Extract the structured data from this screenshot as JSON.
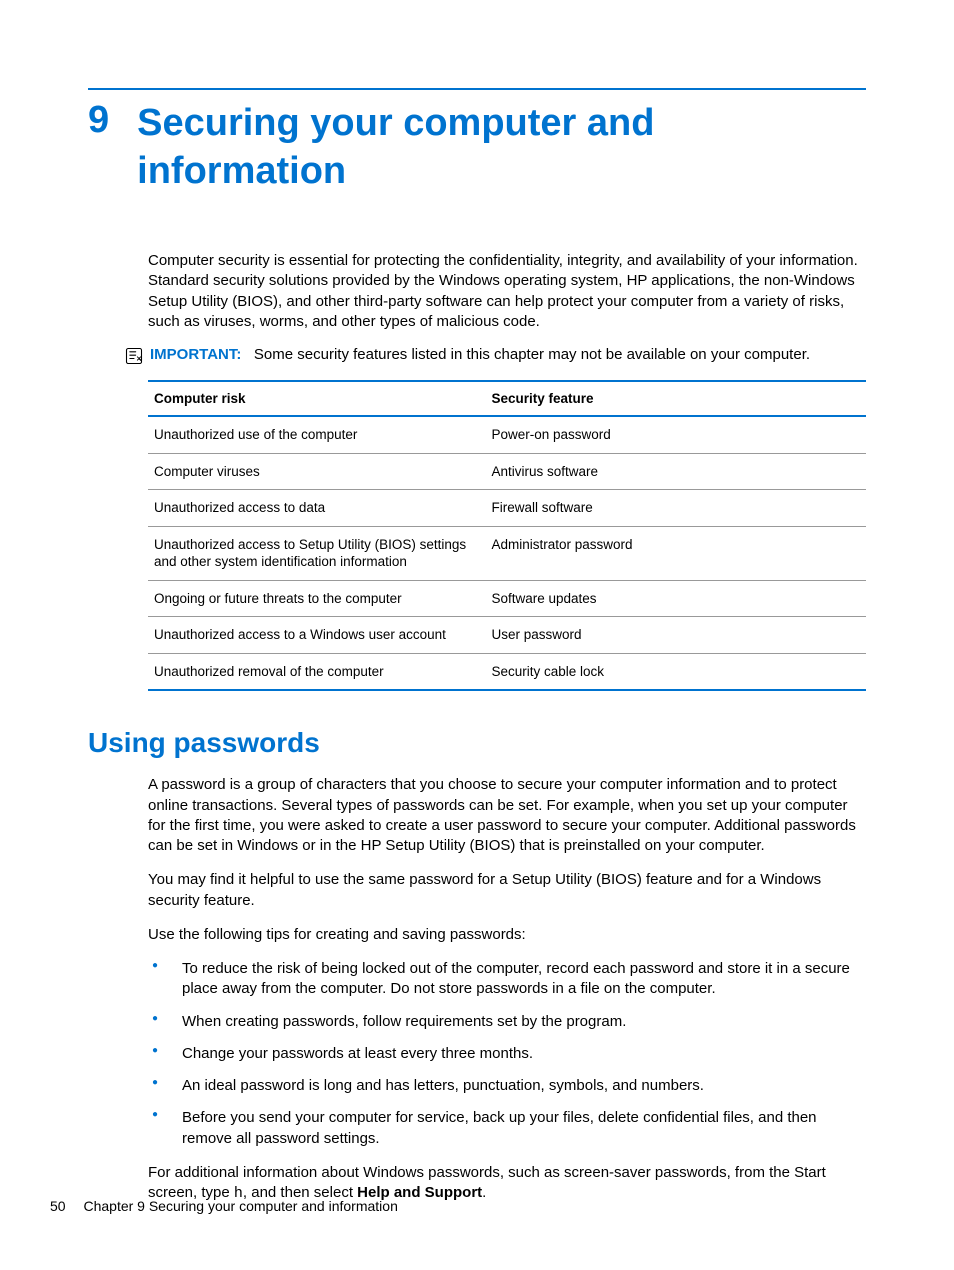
{
  "chapter": {
    "number": "9",
    "title": "Securing your computer and information"
  },
  "intro_paragraph": "Computer security is essential for protecting the confidentiality, integrity, and availability of your information. Standard security solutions provided by the Windows operating system, HP applications, the non-Windows Setup Utility (BIOS), and other third-party software can help protect your computer from a variety of risks, such as viruses, worms, and other types of malicious code.",
  "important_note": {
    "label": "IMPORTANT:",
    "text": "Some security features listed in this chapter may not be available on your computer."
  },
  "table": {
    "headers": {
      "risk": "Computer risk",
      "feature": "Security feature"
    },
    "rows": [
      {
        "risk": "Unauthorized use of the computer",
        "feature": "Power-on password"
      },
      {
        "risk": "Computer viruses",
        "feature": "Antivirus software"
      },
      {
        "risk": "Unauthorized access to data",
        "feature": "Firewall software"
      },
      {
        "risk": "Unauthorized access to Setup Utility (BIOS) settings and other system identification information",
        "feature": "Administrator password"
      },
      {
        "risk": "Ongoing or future threats to the computer",
        "feature": "Software updates"
      },
      {
        "risk": "Unauthorized access to a Windows user account",
        "feature": "User password"
      },
      {
        "risk": "Unauthorized removal of the computer",
        "feature": "Security cable lock"
      }
    ]
  },
  "section": {
    "title": "Using passwords",
    "p1": "A password is a group of characters that you choose to secure your computer information and to protect online transactions. Several types of passwords can be set. For example, when you set up your computer for the first time, you were asked to create a user password to secure your computer. Additional passwords can be set in Windows or in the HP Setup Utility (BIOS) that is preinstalled on your computer.",
    "p2": "You may find it helpful to use the same password for a Setup Utility (BIOS) feature and for a Windows security feature.",
    "p3": "Use the following tips for creating and saving passwords:",
    "bullets": [
      "To reduce the risk of being locked out of the computer, record each password and store it in a secure place away from the computer. Do not store passwords in a file on the computer.",
      "When creating passwords, follow requirements set by the program.",
      "Change your passwords at least every three months.",
      "An ideal password is long and has letters, punctuation, symbols, and numbers.",
      "Before you send your computer for service, back up your files, delete confidential files, and then remove all password settings."
    ],
    "p4_pre": "For additional information about Windows passwords, such as screen-saver passwords, from the Start screen, type ",
    "p4_code": "h",
    "p4_mid": ", and then select ",
    "p4_bold": "Help and Support",
    "p4_end": "."
  },
  "footer": {
    "page": "50",
    "text": "Chapter 9   Securing your computer and information"
  }
}
